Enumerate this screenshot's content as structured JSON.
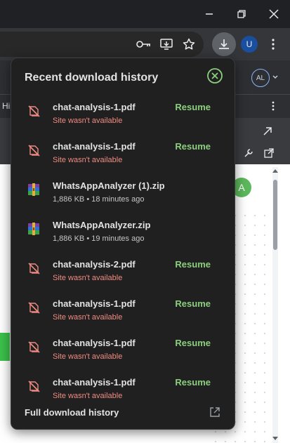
{
  "browser": {
    "profile_initial": "U"
  },
  "background": {
    "avatar_initials": "AL",
    "green_avatar": "A",
    "hint_text": "Hi"
  },
  "popup": {
    "title": "Recent download history",
    "resume_label": "Resume",
    "footer_label": "Full download history",
    "items": [
      {
        "name": "chat-analysis-1.pdf",
        "status": "Site wasn't available",
        "kind": "blocked-pdf",
        "resumable": true
      },
      {
        "name": "chat-analysis-1.pdf",
        "status": "Site wasn't available",
        "kind": "blocked-pdf",
        "resumable": true
      },
      {
        "name": "WhatsAppAnalyzer (1).zip",
        "status": "1,886 KB • 18 minutes ago",
        "kind": "zip-archive",
        "resumable": false
      },
      {
        "name": "WhatsAppAnalyzer.zip",
        "status": "1,886 KB • 19 minutes ago",
        "kind": "zip-archive",
        "resumable": false
      },
      {
        "name": "chat-analysis-2.pdf",
        "status": "Site wasn't available",
        "kind": "blocked-pdf",
        "resumable": true
      },
      {
        "name": "chat-analysis-1.pdf",
        "status": "Site wasn't available",
        "kind": "blocked-pdf",
        "resumable": true
      },
      {
        "name": "chat-analysis-1.pdf",
        "status": "Site wasn't available",
        "kind": "blocked-pdf",
        "resumable": true
      },
      {
        "name": "chat-analysis-1.pdf",
        "status": "Site wasn't available",
        "kind": "blocked-pdf",
        "resumable": true
      }
    ]
  },
  "colors": {
    "resume": "#8ccf7e",
    "error": "#f28b82",
    "popup_bg": "#1f201f"
  }
}
